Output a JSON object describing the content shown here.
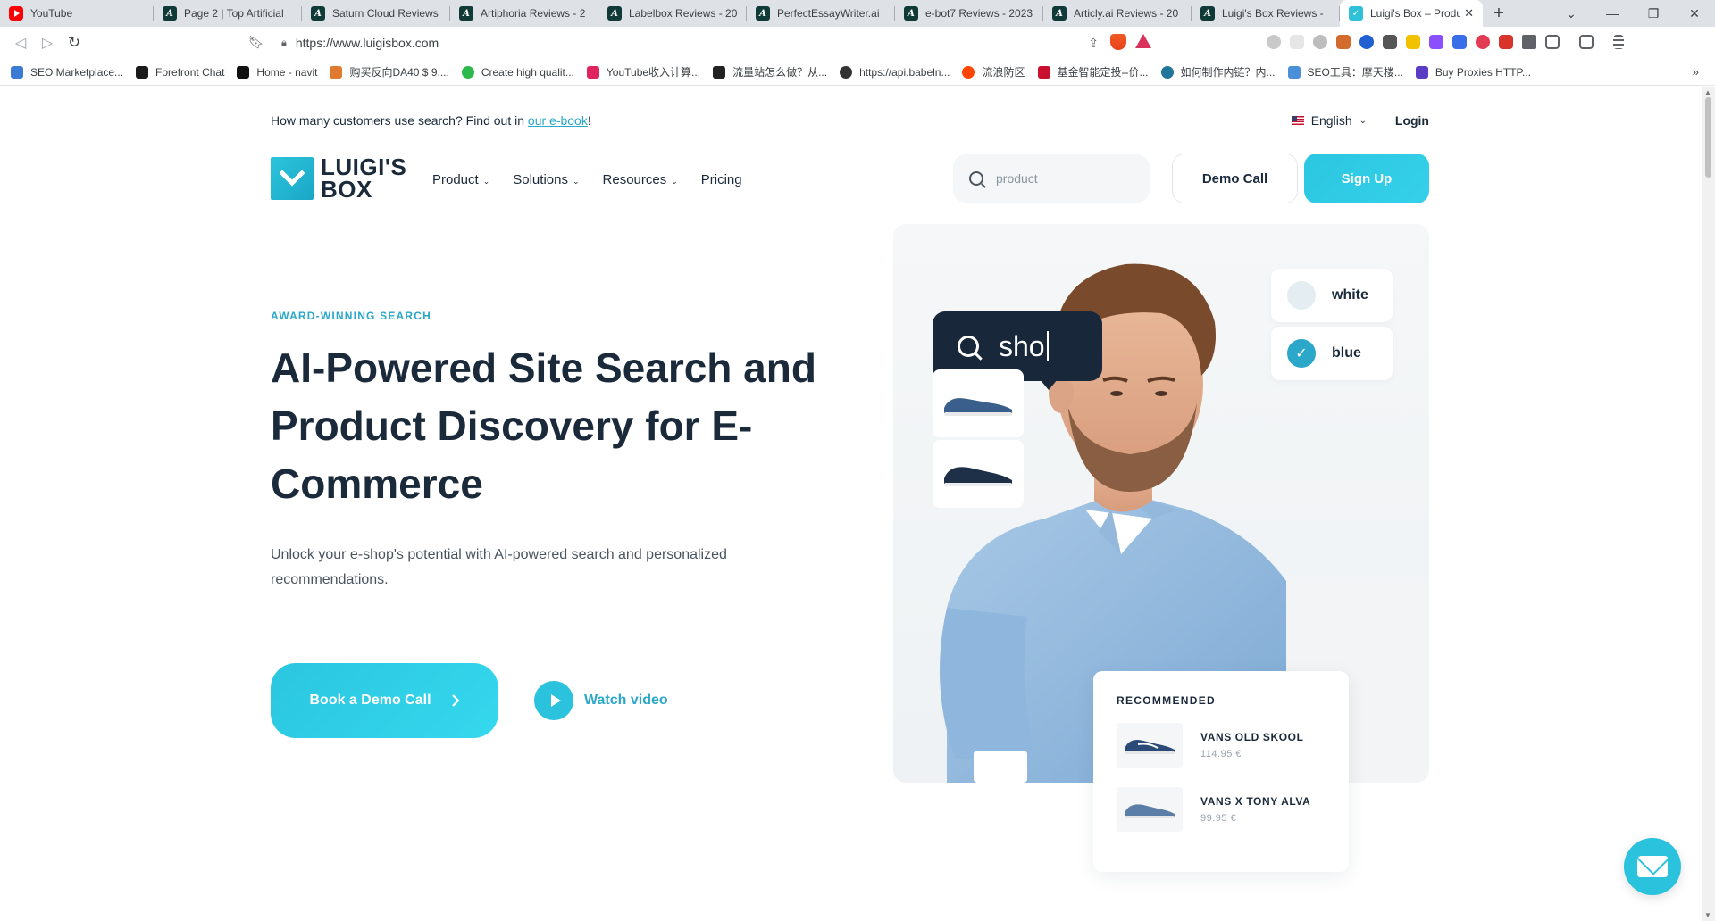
{
  "browser": {
    "tabs": [
      {
        "title": "YouTube",
        "icon": "youtube-icon"
      },
      {
        "title": "Page 2 | Top Artificial",
        "icon": "topai-icon"
      },
      {
        "title": "Saturn Cloud Reviews",
        "icon": "topai-icon"
      },
      {
        "title": "Artiphoria Reviews - 2",
        "icon": "topai-icon"
      },
      {
        "title": "Labelbox Reviews - 20",
        "icon": "topai-icon"
      },
      {
        "title": "PerfectEssayWriter.ai",
        "icon": "topai-icon"
      },
      {
        "title": "e-bot7 Reviews - 2023",
        "icon": "topai-icon"
      },
      {
        "title": "Articly.ai Reviews - 20",
        "icon": "topai-icon"
      },
      {
        "title": "Luigi's Box Reviews - ",
        "icon": "topai-icon"
      },
      {
        "title": "Luigi's Box – Produ",
        "icon": "luigisbox-icon",
        "active": true
      }
    ],
    "url": "https://www.luigisbox.com",
    "bookmarks": [
      {
        "label": "SEO Marketplace...",
        "color": "#3b7bd4"
      },
      {
        "label": "Forefront Chat",
        "color": "#1b1b1b"
      },
      {
        "label": "Home - navit",
        "color": "#111111"
      },
      {
        "label": "购买反向DA40 $ 9....",
        "color": "#e07a2e"
      },
      {
        "label": "Create high qualit...",
        "color": "#2db84c"
      },
      {
        "label": "YouTube收入计算...",
        "color": "#e0245e"
      },
      {
        "label": "流量站怎么做？从...",
        "color": "#222222"
      },
      {
        "label": "https://api.babeln...",
        "color": "#333333"
      },
      {
        "label": "流浪防区",
        "color": "#ff4500"
      },
      {
        "label": "基金智能定投--价...",
        "color": "#c8102e"
      },
      {
        "label": "如何制作内链？内...",
        "color": "#21759b"
      },
      {
        "label": "SEO工具：摩天楼...",
        "color": "#4a90d9"
      },
      {
        "label": "Buy Proxies HTTP...",
        "color": "#5b3cc4"
      }
    ]
  },
  "site": {
    "announcement": {
      "text": "How many customers use search? Find out in ",
      "link": "our e-book",
      "suffix": "!"
    },
    "language": "English",
    "login": "Login",
    "logo": {
      "line1": "LUIGI'S",
      "line2": "BOX"
    },
    "nav": [
      {
        "label": "Product",
        "dropdown": true
      },
      {
        "label": "Solutions",
        "dropdown": true
      },
      {
        "label": "Resources",
        "dropdown": true
      },
      {
        "label": "Pricing",
        "dropdown": false
      }
    ],
    "search": {
      "placeholder": "product"
    },
    "demo_call": "Demo Call",
    "sign_up": "Sign Up"
  },
  "hero": {
    "eyebrow": "AWARD-WINNING SEARCH",
    "title": "AI-Powered Site Search and Product Discovery for E-Commerce",
    "subtitle": "Unlock your e-shop's potential with AI-powered search and personalized recommendations.",
    "cta_primary": "Book a Demo Call",
    "cta_secondary": "Watch video"
  },
  "visual": {
    "search_query": "sho",
    "filters": [
      {
        "label": "white",
        "checked": false
      },
      {
        "label": "blue",
        "checked": true
      }
    ],
    "recommended_title": "RECOMMENDED",
    "recommended": [
      {
        "name": "VANS OLD SKOOL",
        "price": "114.95 €"
      },
      {
        "name": "VANS X TONY ALVA",
        "price": "99.95 €"
      }
    ]
  },
  "colors": {
    "accent": "#2AC2DC",
    "accent_text": "#2AA7C9",
    "dark": "#1B2A3A"
  }
}
